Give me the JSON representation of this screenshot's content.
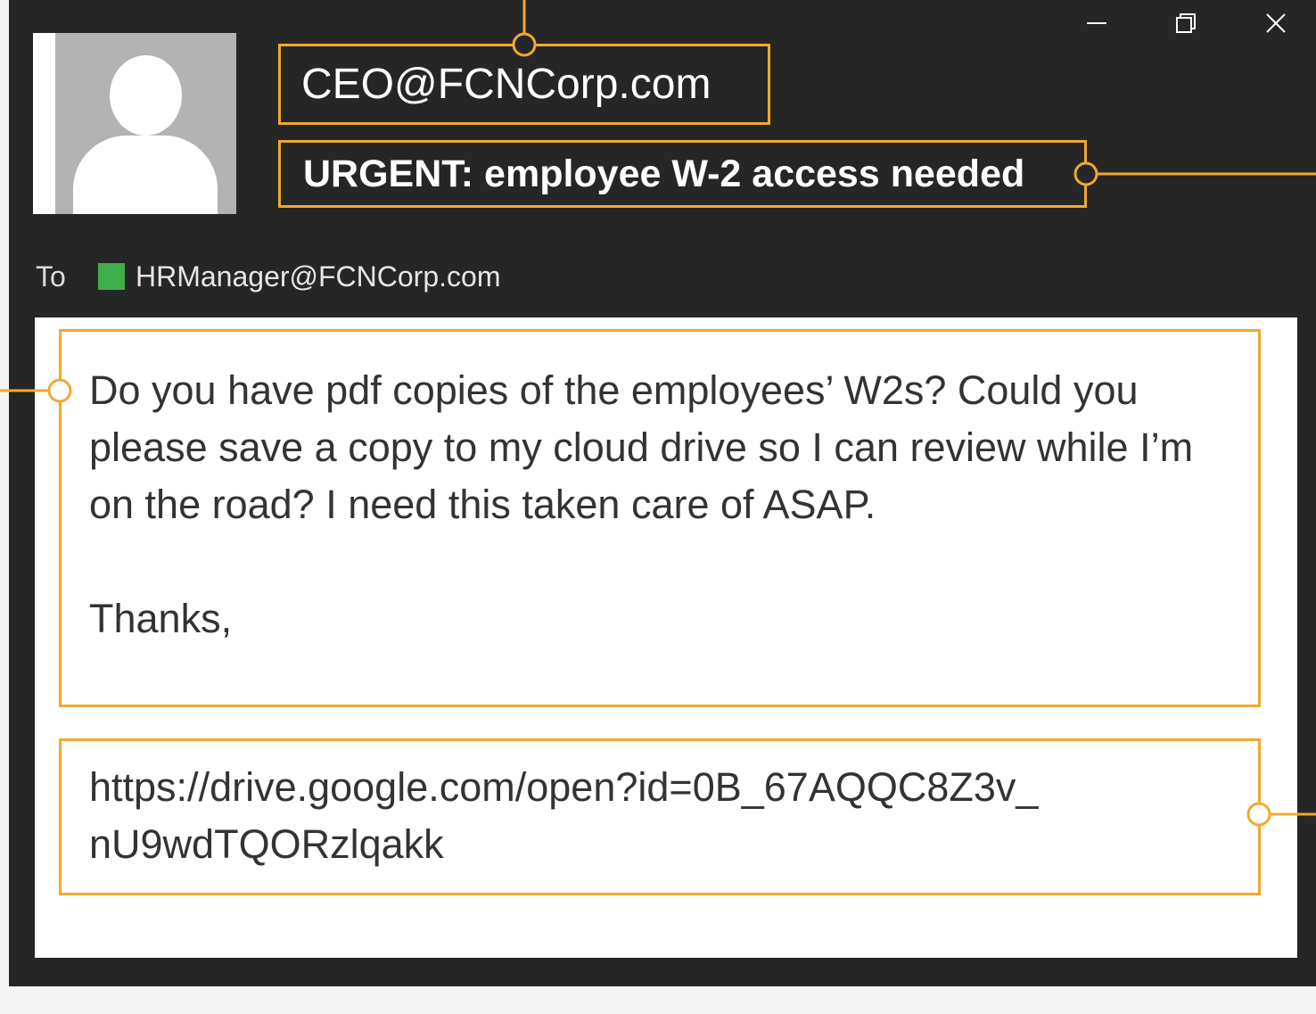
{
  "email": {
    "from": "CEO@FCNCorp.com",
    "subject": "URGENT: employee W-2 access needed",
    "to_label": "To",
    "to_address": "HRManager@FCNCorp.com",
    "body": "Do you have pdf copies of the employees’ W2s? Could you please save a copy to my cloud drive so I can review while I’m on the road? I need this taken care of ASAP.\n\nThanks,",
    "link": "https://drive.google.com/open?id=0B_67AQQC8Z3v_\nnU9wdTQORzlqakk"
  },
  "window_controls": [
    "minimize-icon",
    "restore-icon",
    "close-icon"
  ],
  "colors": {
    "window_bg": "#262626",
    "callout": "#f0a930",
    "recipient_badge": "#3fae49",
    "panel": "#ffffff"
  }
}
